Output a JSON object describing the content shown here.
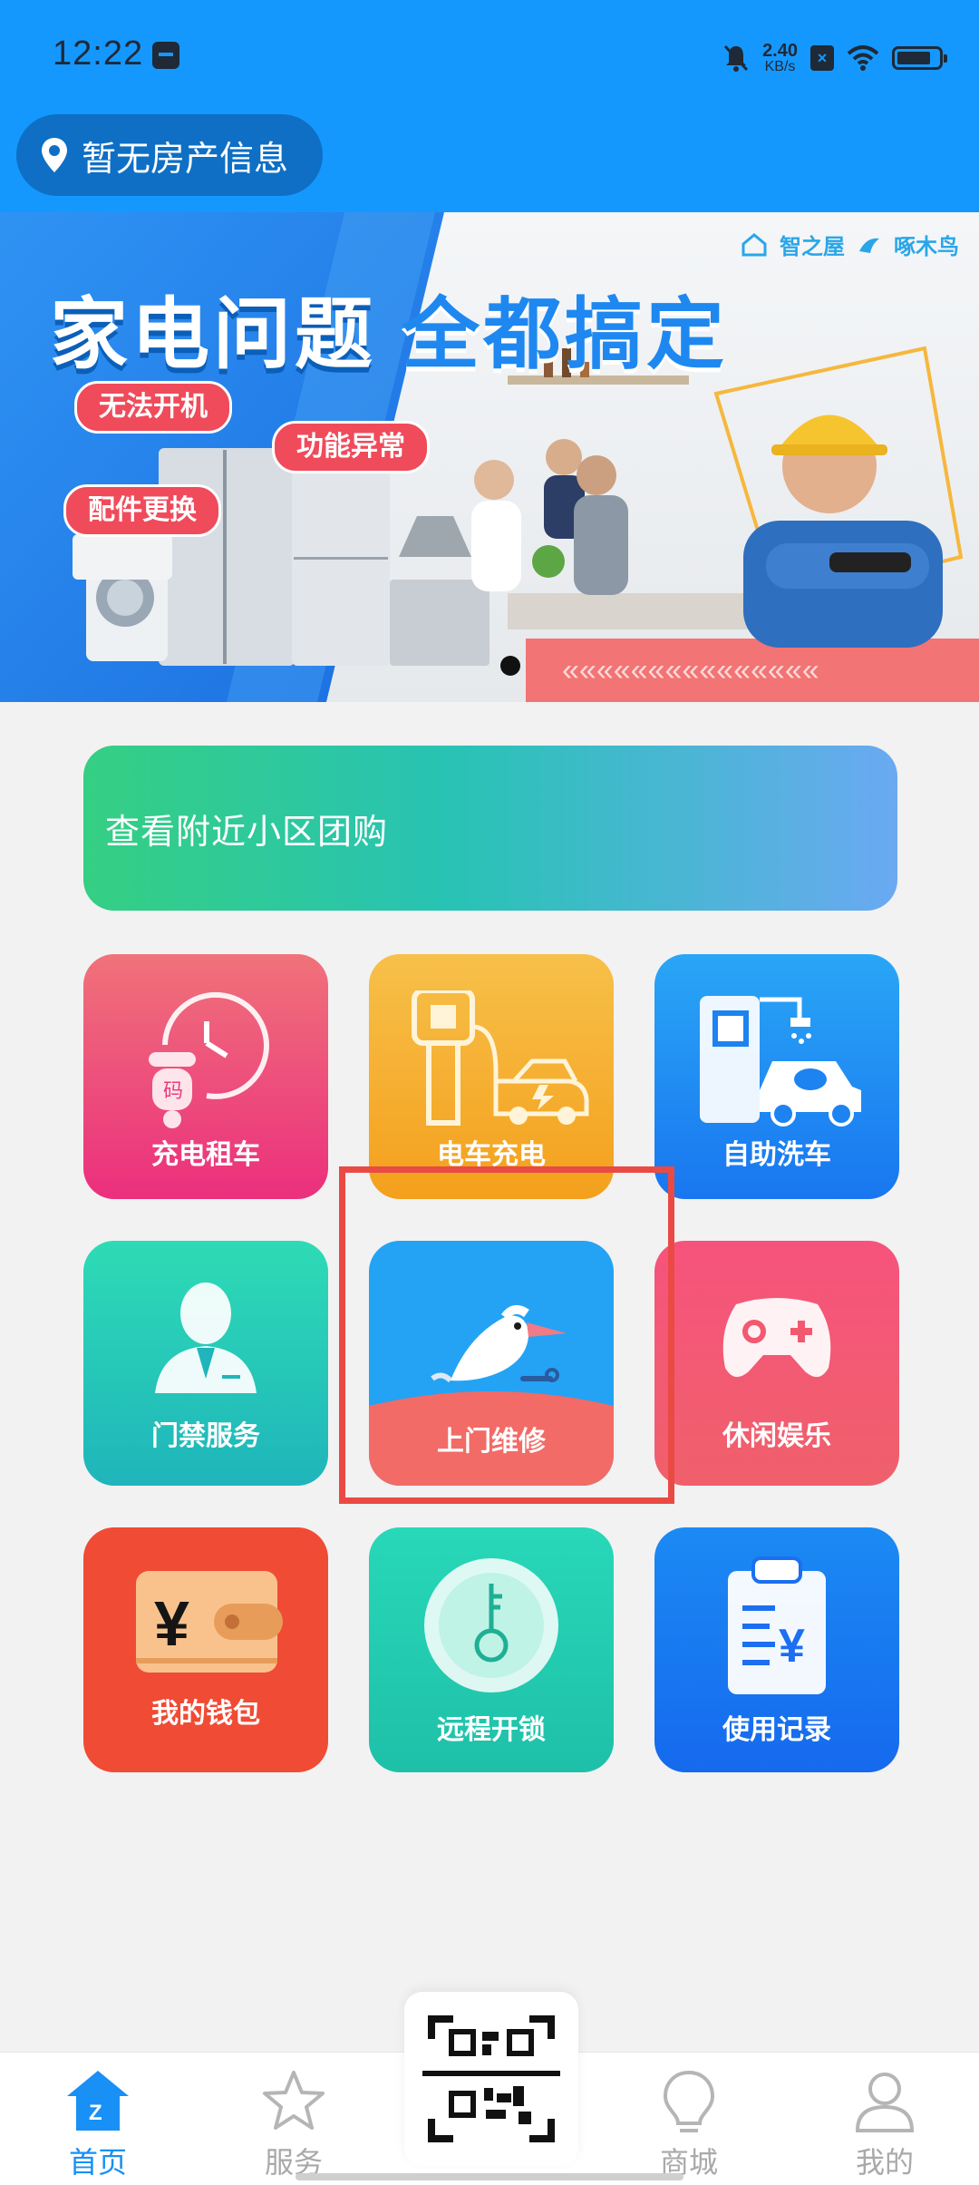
{
  "status_bar": {
    "time": "12:22",
    "speed_value": "2.40",
    "speed_unit": "KB/s"
  },
  "header": {
    "location_label": "暂无房产信息"
  },
  "banner": {
    "title_part1": "家电问题",
    "title_part2": "全都搞定",
    "brand_left": "智之屋",
    "brand_right": "啄木鸟",
    "tag_1": "无法开机",
    "tag_2": "功能异常",
    "tag_3": "配件更换"
  },
  "group_buy": {
    "label": "查看附近小区团购"
  },
  "tiles": [
    {
      "label": "充电租车"
    },
    {
      "label": "电车充电"
    },
    {
      "label": "自助洗车"
    },
    {
      "label": "门禁服务"
    },
    {
      "label": "上门维修"
    },
    {
      "label": "休闲娱乐"
    },
    {
      "label": "我的钱包"
    },
    {
      "label": "远程开锁"
    },
    {
      "label": "使用记录"
    }
  ],
  "icon_text": {
    "meter_char": "码",
    "currency": "¥"
  },
  "bottom_nav": {
    "home": "首页",
    "service": "服务",
    "mall": "商城",
    "mine": "我的"
  },
  "colors": {
    "primary": "#1598fd",
    "highlight_box": "#ea4a44"
  }
}
